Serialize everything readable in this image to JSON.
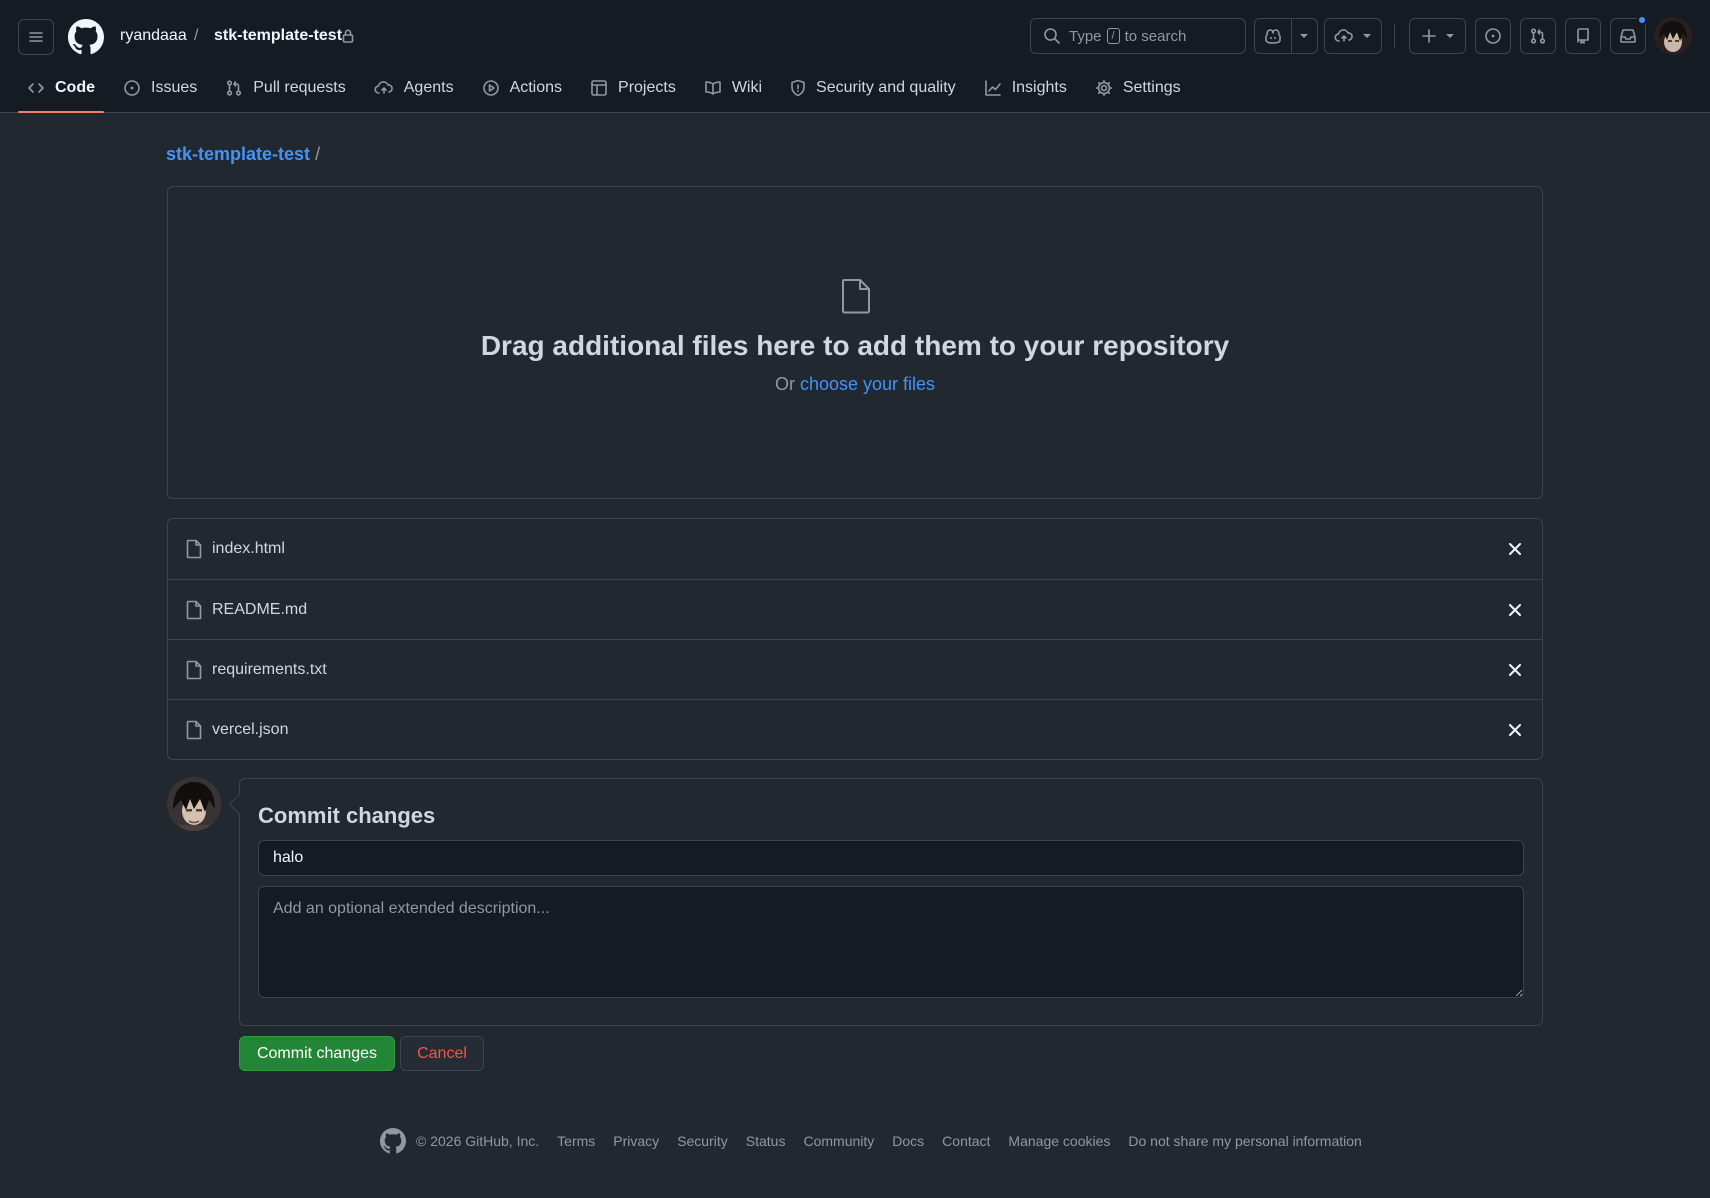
{
  "header": {
    "owner": "ryandaaa",
    "separator": "/",
    "repo": "stk-template-test",
    "search": {
      "prefix": "Type",
      "key": "/",
      "suffix": "to search"
    }
  },
  "tabs": [
    {
      "label": "Code",
      "icon": "code-icon",
      "active": true
    },
    {
      "label": "Issues",
      "icon": "issue-opened-icon"
    },
    {
      "label": "Pull requests",
      "icon": "git-pull-request-icon"
    },
    {
      "label": "Agents",
      "icon": "agent-icon"
    },
    {
      "label": "Actions",
      "icon": "play-icon"
    },
    {
      "label": "Projects",
      "icon": "table-icon"
    },
    {
      "label": "Wiki",
      "icon": "book-icon"
    },
    {
      "label": "Security and quality",
      "icon": "shield-icon"
    },
    {
      "label": "Insights",
      "icon": "graph-icon"
    },
    {
      "label": "Settings",
      "icon": "gear-icon"
    }
  ],
  "breadcrumb": {
    "repo": "stk-template-test",
    "separator": "/"
  },
  "dropzone": {
    "title": "Drag additional files here to add them to your repository",
    "or_text": "Or",
    "link_text": "choose your files"
  },
  "files": [
    {
      "name": "index.html"
    },
    {
      "name": "README.md"
    },
    {
      "name": "requirements.txt"
    },
    {
      "name": "vercel.json"
    }
  ],
  "commit": {
    "title": "Commit changes",
    "message_value": "halo",
    "description_placeholder": "Add an optional extended description...",
    "commit_button": "Commit changes",
    "cancel_button": "Cancel"
  },
  "footer": {
    "copyright": "© 2026 GitHub, Inc.",
    "links": [
      "Terms",
      "Privacy",
      "Security",
      "Status",
      "Community",
      "Docs",
      "Contact",
      "Manage cookies",
      "Do not share my personal information"
    ]
  },
  "colors": {
    "background": "#212830",
    "header_bg": "#151b23",
    "border": "#3d444d",
    "link": "#4493f8",
    "tab_underline": "#f78166",
    "commit_green": "#238636",
    "cancel_red": "#f85149"
  }
}
